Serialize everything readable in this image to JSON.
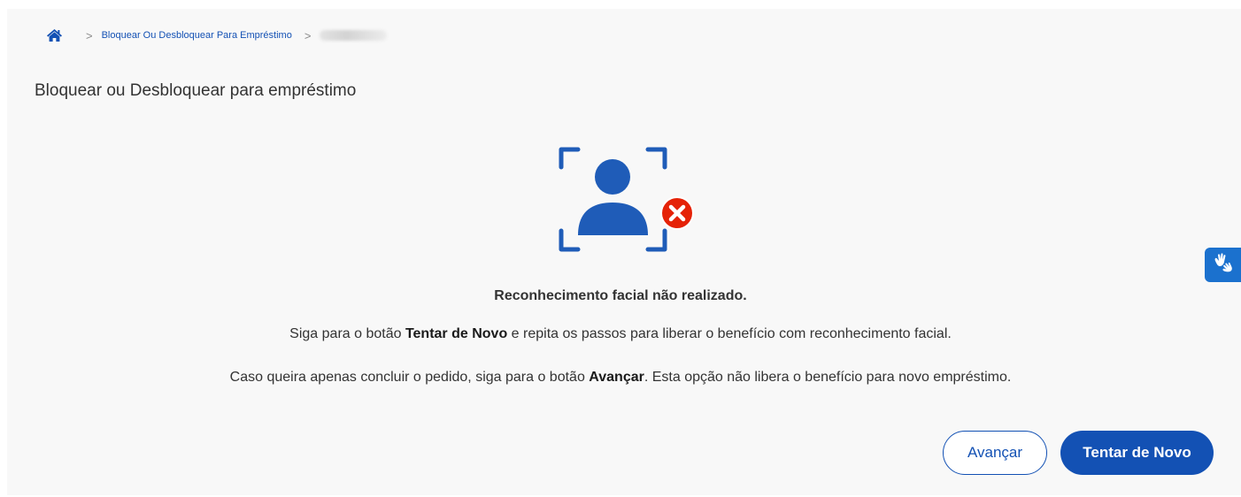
{
  "breadcrumb": {
    "home_icon": "home-icon",
    "separator": ">",
    "current": "Bloquear Ou Desbloquear Para Empréstimo"
  },
  "page": {
    "title": "Bloquear ou Desbloquear para empréstimo"
  },
  "status": {
    "illustration_icon": "face-recognition-failed-icon",
    "title": "Reconhecimento facial não realizado."
  },
  "instructions": {
    "line1_before": "Siga para o botão ",
    "line1_bold": "Tentar de Novo",
    "line1_after": " e repita os passos para liberar o benefício com reconhecimento facial.",
    "line2_before": "Caso queira apenas concluir o pedido, siga para o botão ",
    "line2_bold": "Avançar",
    "line2_after": ". Esta opção não libera o benefício para novo empréstimo."
  },
  "actions": {
    "secondary_label": "Avançar",
    "primary_label": "Tentar de Novo"
  },
  "accessibility": {
    "vlibras_icon": "sign-language-hands-icon"
  },
  "colors": {
    "primary": "#1351b4",
    "error": "#e52207",
    "icon_blue": "#1f5cb8",
    "vlibras": "#1b71ce"
  }
}
